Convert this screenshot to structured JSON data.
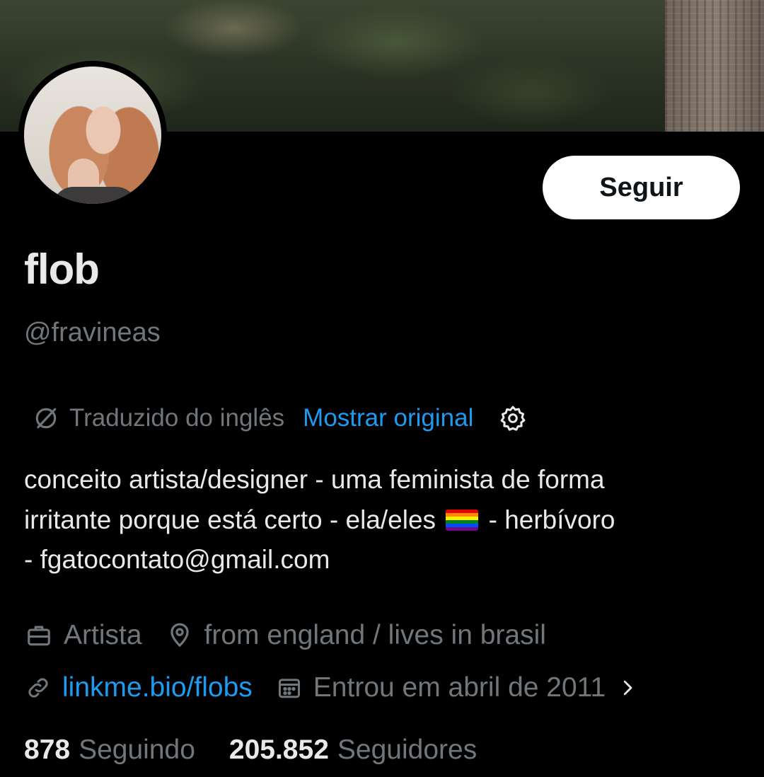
{
  "profile": {
    "display_name": "flob",
    "handle": "@fravineas",
    "follow_label": "Seguir"
  },
  "translation": {
    "notice": "Traduzido do inglês",
    "show_original": "Mostrar original"
  },
  "bio": {
    "line1": "conceito artista/designer - uma feminista de forma",
    "line2_a": "irritante porque está certo - ela/eles",
    "line2_b": "- herbívoro",
    "line3": "- fgatocontato@gmail.com"
  },
  "meta": {
    "profession": "Artista",
    "location": "from england / lives in brasil",
    "website": "linkme.bio/flobs",
    "joined": "Entrou em abril de 2011"
  },
  "stats": {
    "following_count": "878",
    "following_label": "Seguindo",
    "followers_count": "205.852",
    "followers_label": "Seguidores"
  },
  "colors": {
    "background": "#000000",
    "text": "#e7e9ea",
    "muted": "#71767b",
    "link": "#1d9bf0"
  },
  "icons": [
    "translate-icon",
    "gear-icon",
    "briefcase-icon",
    "location-pin-icon",
    "link-icon",
    "calendar-icon",
    "chevron-right-icon",
    "pride-flag-emoji"
  ]
}
